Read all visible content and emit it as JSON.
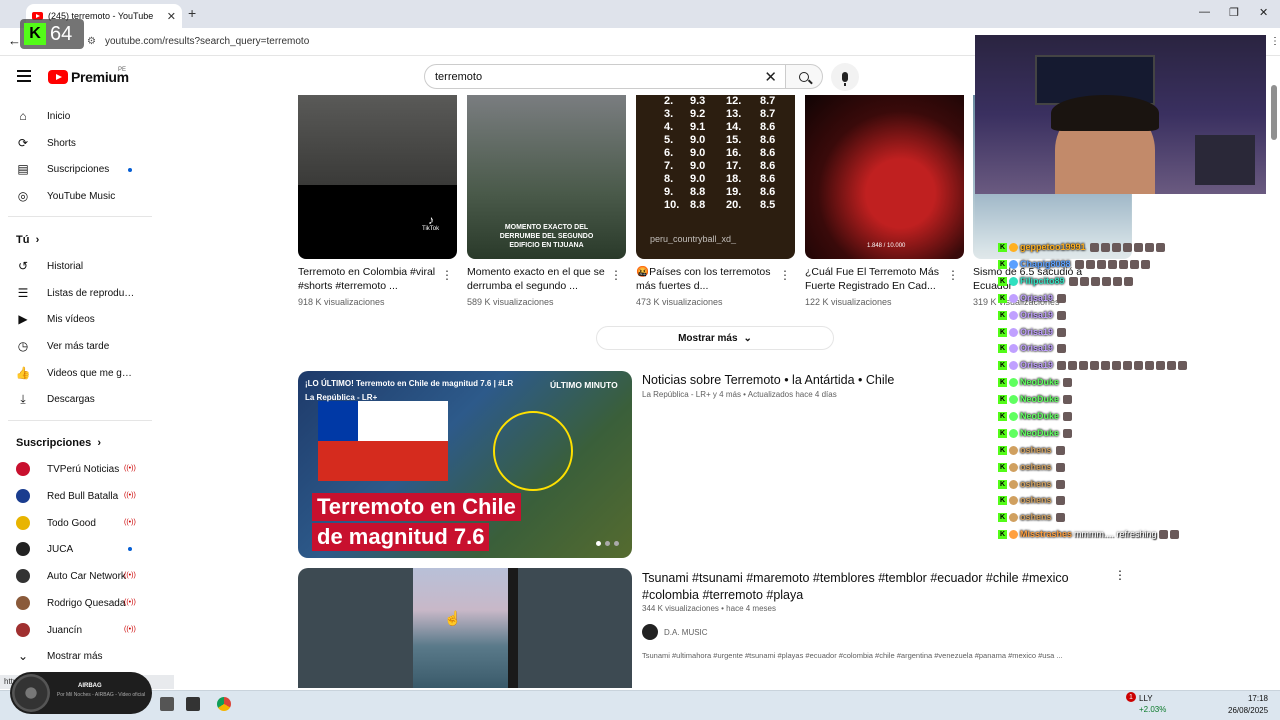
{
  "browser": {
    "tab_title": "(245) terremoto - YouTube",
    "url": "youtube.com/results?search_query=terremoto",
    "status_url": "https://www.youtube.com/...LIGI_QA"
  },
  "extension": {
    "count": "64"
  },
  "header": {
    "logo_text": "Premium",
    "logo_country": "PE",
    "search_value": "terremoto"
  },
  "sidebar": {
    "main": [
      "Inicio",
      "Shorts",
      "Suscripciones",
      "YouTube Music"
    ],
    "you_heading": "Tú",
    "you": [
      "Historial",
      "Listas de reproducc...",
      "Mis vídeos",
      "Ver más tarde",
      "Videos que me gus...",
      "Descargas"
    ],
    "subs_heading": "Suscripciones",
    "subs": [
      {
        "name": "TVPerú Noticias",
        "color": "#c8102e",
        "state": "live"
      },
      {
        "name": "Red Bull Batalla",
        "color": "#1a3d8f",
        "state": "live"
      },
      {
        "name": "Todo Good",
        "color": "#e8b400",
        "state": "live"
      },
      {
        "name": "JUCA",
        "color": "#222222",
        "state": "new"
      },
      {
        "name": "Auto Car Network",
        "color": "#333333",
        "state": "live"
      },
      {
        "name": "Rodrigo Quesada",
        "color": "#8a5a3a",
        "state": "live"
      },
      {
        "name": "Juancín",
        "color": "#a03030",
        "state": "live"
      }
    ],
    "show_more": "Mostrar más"
  },
  "shorts": [
    {
      "title": "Terremoto en Colombia #viral #shorts #terremoto ...",
      "views": "918 K visualizaciones",
      "overlay": "TikTok"
    },
    {
      "title": "Momento exacto en el que se derrumba el segundo ...",
      "views": "589 K visualizaciones",
      "overlay": "MOMENTO EXACTO DEL DERRUMBE DEL SEGUNDO EDIFICIO EN TIJUANA"
    },
    {
      "title": "🤬Países con los terremotos más fuertes d...",
      "views": "473 K visualizaciones",
      "overlay": "peru_countryball_xd_"
    },
    {
      "title": "¿Cuál Fue El Terremoto Más Fuerte Registrado En Cad...",
      "views": "122 K visualizaciones",
      "overlay": "1.848 / 10.000"
    },
    {
      "title": "Sismo de 6.5 sacudió a Ecuador",
      "views": "319 K visualizaciones",
      "overlay": ""
    }
  ],
  "ranking": {
    "left": [
      "2.",
      "3.",
      "4.",
      "5.",
      "6.",
      "7.",
      "8.",
      "9.",
      "10."
    ],
    "left_vals": [
      "9.3",
      "9.2",
      "9.1",
      "9.0",
      "9.0",
      "9.0",
      "9.0",
      "8.8",
      "8.8"
    ],
    "right": [
      "12.",
      "13.",
      "14.",
      "15.",
      "16.",
      "17.",
      "18.",
      "19.",
      "20."
    ],
    "right_vals": [
      "8.7",
      "8.7",
      "8.6",
      "8.6",
      "8.6",
      "8.6",
      "8.6",
      "8.6",
      "8.5"
    ]
  },
  "show_more_button": "Mostrar más",
  "result1": {
    "title": "Noticias sobre Terremoto • la Antártida • Chile",
    "meta": "La República - LR+ y 4 más • Actualizados hace 4 días",
    "thumb_top": "¡LO ÚLTIMO! Terremoto en Chile de magnitud 7.6 | #LR",
    "thumb_channel": "La República - LR+",
    "thumb_tag": "ÚLTIMO MINUTO",
    "thumb_headline1": "Terremoto en Chile",
    "thumb_headline2": "de magnitud 7.6"
  },
  "result2": {
    "title": "Tsunami #tsunami #maremoto #temblores #temblor #ecuador #chile #mexico #colombia #terremoto #playa",
    "meta": "344 K visualizaciones • hace 4 meses",
    "channel": "D.A. MUSIC",
    "desc": "Tsunami #ultimahora #urgente #tsunami #playas #ecuador #colombia #chile #argentina #venezuela #panama #mexico #usa ..."
  },
  "chat": [
    {
      "user": "geppetoo19991",
      "color": "#ffb020",
      "msg": "",
      "emotes": 7
    },
    {
      "user": "Chapig8088",
      "color": "#5aa0ff",
      "msg": "",
      "emotes": 7
    },
    {
      "user": "Filipcito89",
      "color": "#30e0c0",
      "msg": "",
      "emotes": 6
    },
    {
      "user": "Orisa19",
      "color": "#c0a0ff",
      "msg": "",
      "emotes": 1
    },
    {
      "user": "Orisa19",
      "color": "#c0a0ff",
      "msg": "",
      "emotes": 1
    },
    {
      "user": "Orisa19",
      "color": "#c0a0ff",
      "msg": "",
      "emotes": 1
    },
    {
      "user": "Orisa19",
      "color": "#c0a0ff",
      "msg": "",
      "emotes": 1
    },
    {
      "user": "Orisa19",
      "color": "#c0a0ff",
      "msg": "",
      "emotes": 12
    },
    {
      "user": "NeoDuke",
      "color": "#60ff60",
      "msg": "",
      "emotes": 1
    },
    {
      "user": "NeoDuke",
      "color": "#60ff60",
      "msg": "",
      "emotes": 1
    },
    {
      "user": "NeoDuke",
      "color": "#60ff60",
      "msg": "",
      "emotes": 1
    },
    {
      "user": "NeoDuke",
      "color": "#60ff60",
      "msg": "",
      "emotes": 1
    },
    {
      "user": "oshens",
      "color": "#d0a060",
      "msg": "",
      "emotes": 1
    },
    {
      "user": "oshens",
      "color": "#d0a060",
      "msg": "",
      "emotes": 1
    },
    {
      "user": "oshens",
      "color": "#d0a060",
      "msg": "",
      "emotes": 1
    },
    {
      "user": "oshens",
      "color": "#d0a060",
      "msg": "",
      "emotes": 1
    },
    {
      "user": "oshens",
      "color": "#d0a060",
      "msg": "",
      "emotes": 1
    },
    {
      "user": "Misstrashes",
      "color": "#ffa040",
      "msg": "mmmm.... refreshing",
      "emotes": 2
    }
  ],
  "music": {
    "title": "AIRBAG",
    "subtitle": "Por Mil Noches - AIRBAG - Video oficial"
  },
  "taskbar": {
    "stock": "LLY",
    "stock_change": "+2.03%",
    "badge": "1",
    "time": "17:18",
    "date": "26/08/2025"
  }
}
